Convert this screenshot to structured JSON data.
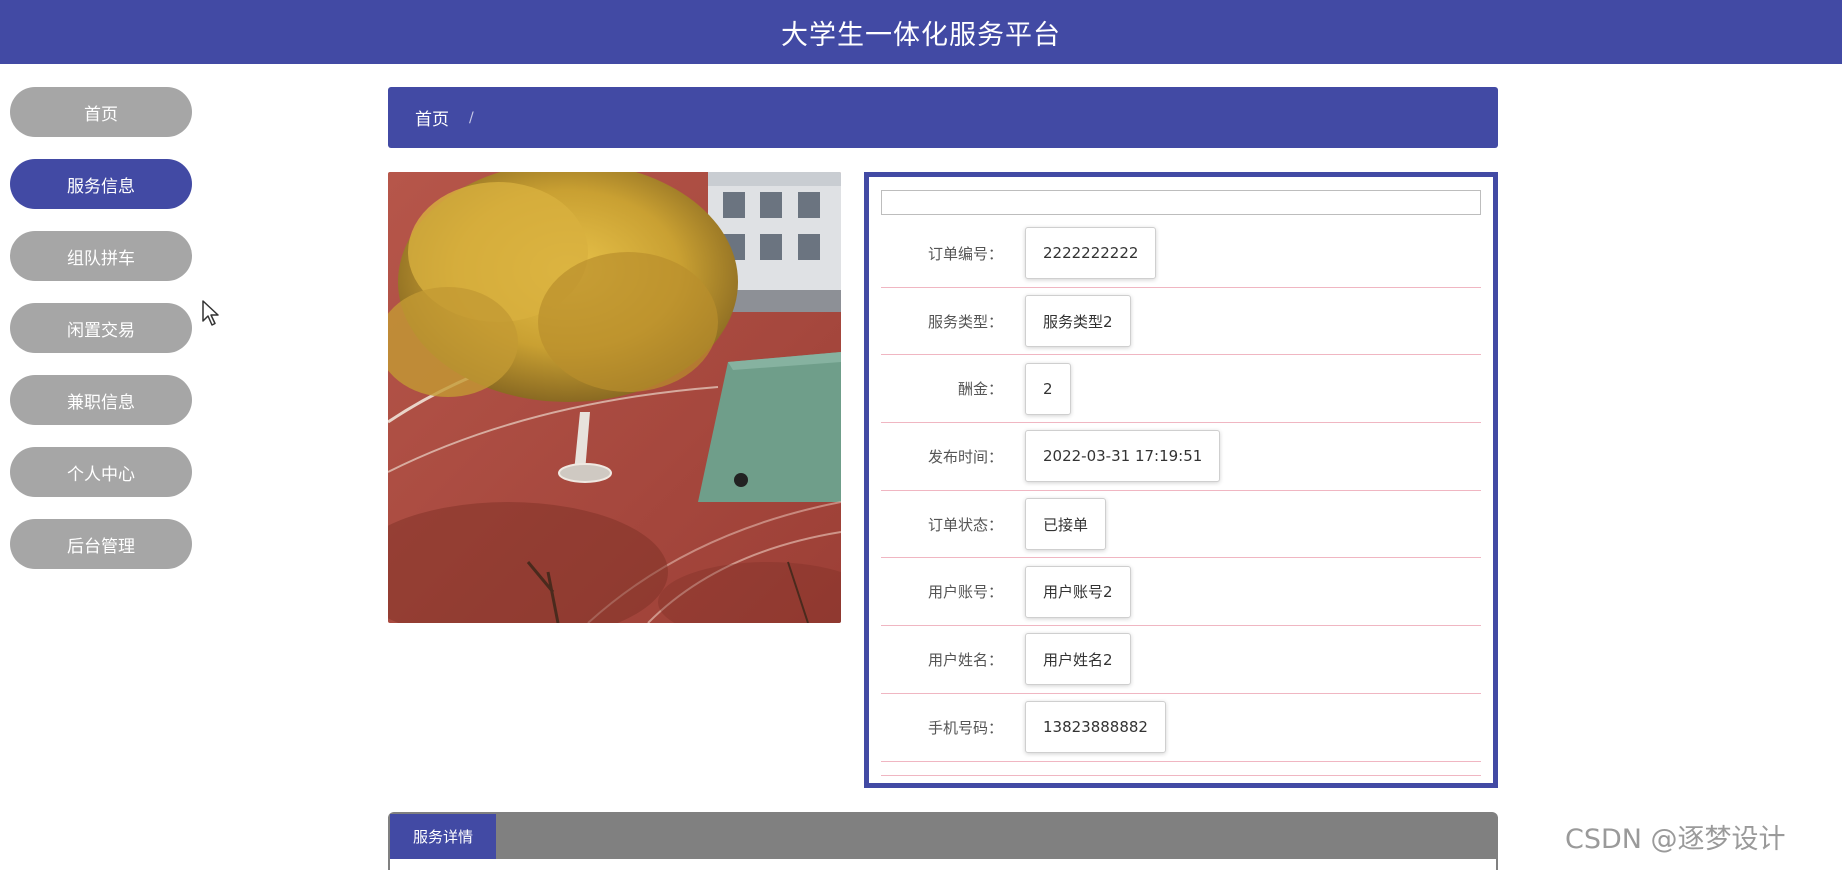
{
  "header": {
    "title": "大学生一体化服务平台"
  },
  "sidebar": {
    "items": [
      {
        "label": "首页"
      },
      {
        "label": "服务信息",
        "active": true
      },
      {
        "label": "组队拼车"
      },
      {
        "label": "闲置交易"
      },
      {
        "label": "兼职信息"
      },
      {
        "label": "个人中心"
      },
      {
        "label": "后台管理"
      }
    ]
  },
  "breadcrumb": {
    "home": "首页",
    "separator": "/"
  },
  "detail": {
    "title": "",
    "fields": [
      {
        "label": "订单编号：",
        "value": "2222222222"
      },
      {
        "label": "服务类型：",
        "value": "服务类型2"
      },
      {
        "label": "酬金：",
        "value": "2"
      },
      {
        "label": "发布时间：",
        "value": "2022-03-31 17:19:51"
      },
      {
        "label": "订单状态：",
        "value": "已接单"
      },
      {
        "label": "用户账号：",
        "value": "用户账号2"
      },
      {
        "label": "用户姓名：",
        "value": "用户姓名2"
      },
      {
        "label": "手机号码：",
        "value": "13823888882"
      }
    ]
  },
  "tabs": {
    "active_label": "服务详情"
  },
  "watermark": "CSDN @逐梦设计",
  "colors": {
    "primary": "#424aa4",
    "nav_inactive": "#a6a6a6",
    "row_divider": "#f0b6c2",
    "tab_bar": "#808080"
  }
}
